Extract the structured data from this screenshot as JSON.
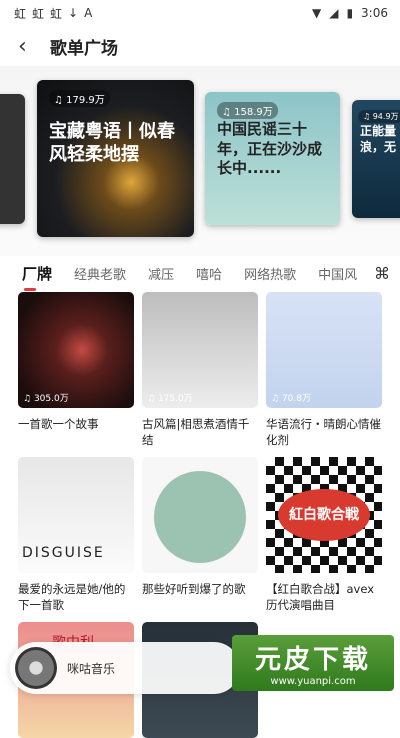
{
  "status": {
    "icons_left": [
      "虹",
      "虹",
      "虹",
      "↓",
      "A"
    ],
    "time": "3:06"
  },
  "header": {
    "back_icon": "‹",
    "title": "歌单广场"
  },
  "carousel": [
    {
      "count": "179.9万",
      "text": "宝藏粤语丨似春风轻柔地摆"
    },
    {
      "count": "158.9万",
      "text": "中国民谣三十年，正在沙沙成长中......"
    },
    {
      "count": "94.9万",
      "text": "正能量浪，无"
    }
  ],
  "tabs": [
    "厂牌",
    "经典老歌",
    "减压",
    "嘻哈",
    "网络热歌",
    "中国风"
  ],
  "tiles": [
    {
      "caption": "一首歌一个故事",
      "count": "305.0万"
    },
    {
      "caption": "古风篇|相思煮酒情千结",
      "count": "175.0万"
    },
    {
      "caption": "华语流行・晴朗心情催化剂",
      "count": "70.8万"
    },
    {
      "caption": "最爱的永远是她/他的下一首歌",
      "count": "",
      "cover_text": "DISGUISE"
    },
    {
      "caption": "那些好听到爆了的歌",
      "count": ""
    },
    {
      "caption": "【红白歌合战】avex 历代演唱曲目",
      "count": "",
      "cover_text": "紅白歌合戦"
    },
    {
      "caption": "",
      "count": "",
      "cover_text": "歌中利"
    },
    {
      "caption": "",
      "count": ""
    }
  ],
  "player": {
    "label": "咪咕音乐"
  },
  "watermark": {
    "main": "元皮下载",
    "url": "www.yuanpi.com"
  }
}
